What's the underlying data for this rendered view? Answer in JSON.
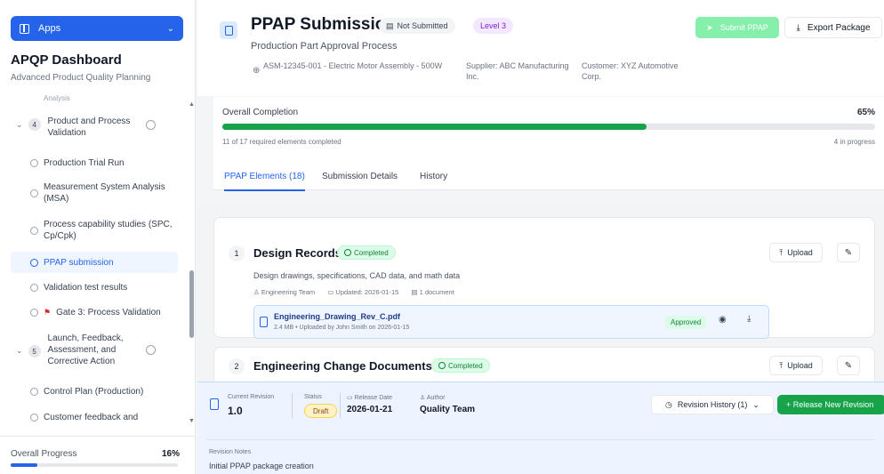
{
  "sidebar": {
    "apps_label": "Apps",
    "title": "APQP Dashboard",
    "subtitle": "Advanced Product Quality Planning",
    "cut_item": "Analysis",
    "phase4": {
      "number": "4",
      "label": "Product and Process Validation"
    },
    "items": [
      {
        "label": "Production Trial Run"
      },
      {
        "label": "Measurement System Analysis (MSA)"
      },
      {
        "label": "Process capability studies (SPC, Cp/Cpk)"
      },
      {
        "label": "PPAP submission"
      },
      {
        "label": "Validation test results"
      },
      {
        "label": "Gate 3: Process Validation"
      }
    ],
    "phase5": {
      "number": "5",
      "label": "Launch, Feedback, Assessment, and Corrective Action"
    },
    "items2": [
      {
        "label": "Control Plan (Production)"
      },
      {
        "label": "Customer feedback and"
      }
    ],
    "progress": {
      "label": "Overall Progress",
      "value": "16%",
      "fraction": 0.16
    }
  },
  "header": {
    "title": "PPAP Submission",
    "status_badge": "Not Submitted",
    "level_badge": "Level 3",
    "subtitle": "Production Part Approval Process",
    "part": "ASM-12345-001 - Electric Motor Assembly - 500W",
    "supplier": "Supplier: ABC Manufacturing Inc.",
    "customer": "Customer: XYZ Automotive Corp.",
    "submit_label": "Submit PPAP",
    "export_label": "Export Package"
  },
  "completion": {
    "label": "Overall Completion",
    "percent": "65%",
    "fraction": 0.65,
    "note": "11 of 17 required elements completed",
    "in_progress": "4 in progress"
  },
  "tabs": [
    {
      "label": "PPAP Elements (18)"
    },
    {
      "label": "Submission Details"
    },
    {
      "label": "History"
    }
  ],
  "elements": [
    {
      "number": "1",
      "title": "Design Records",
      "status": "Completed",
      "description": "Design drawings, specifications, CAD data, and math data",
      "team": "Engineering Team",
      "updated": "Updated: 2026-01-15",
      "docs": "1 document",
      "file": {
        "name": "Engineering_Drawing_Rev_C.pdf",
        "meta": "2.4 MB • Uploaded by John Smith on 2026-01-15",
        "status": "Approved"
      },
      "upload_label": "Upload"
    },
    {
      "number": "2",
      "title": "Engineering Change Documents",
      "status": "Completed",
      "upload_label": "Upload"
    }
  ],
  "revision": {
    "current_label": "Current Revision",
    "current_value": "1.0",
    "status_label": "Status",
    "status_value": "Draft",
    "release_label": "Release Date",
    "release_value": "2026-01-21",
    "author_label": "Author",
    "author_value": "Quality Team",
    "history_label": "Revision History (1)",
    "release_btn": "+ Release New Revision",
    "notes_label": "Revision Notes",
    "notes_value": "Initial PPAP package creation"
  },
  "icons": {
    "accent": "#2563eb",
    "success": "#16a34a"
  }
}
